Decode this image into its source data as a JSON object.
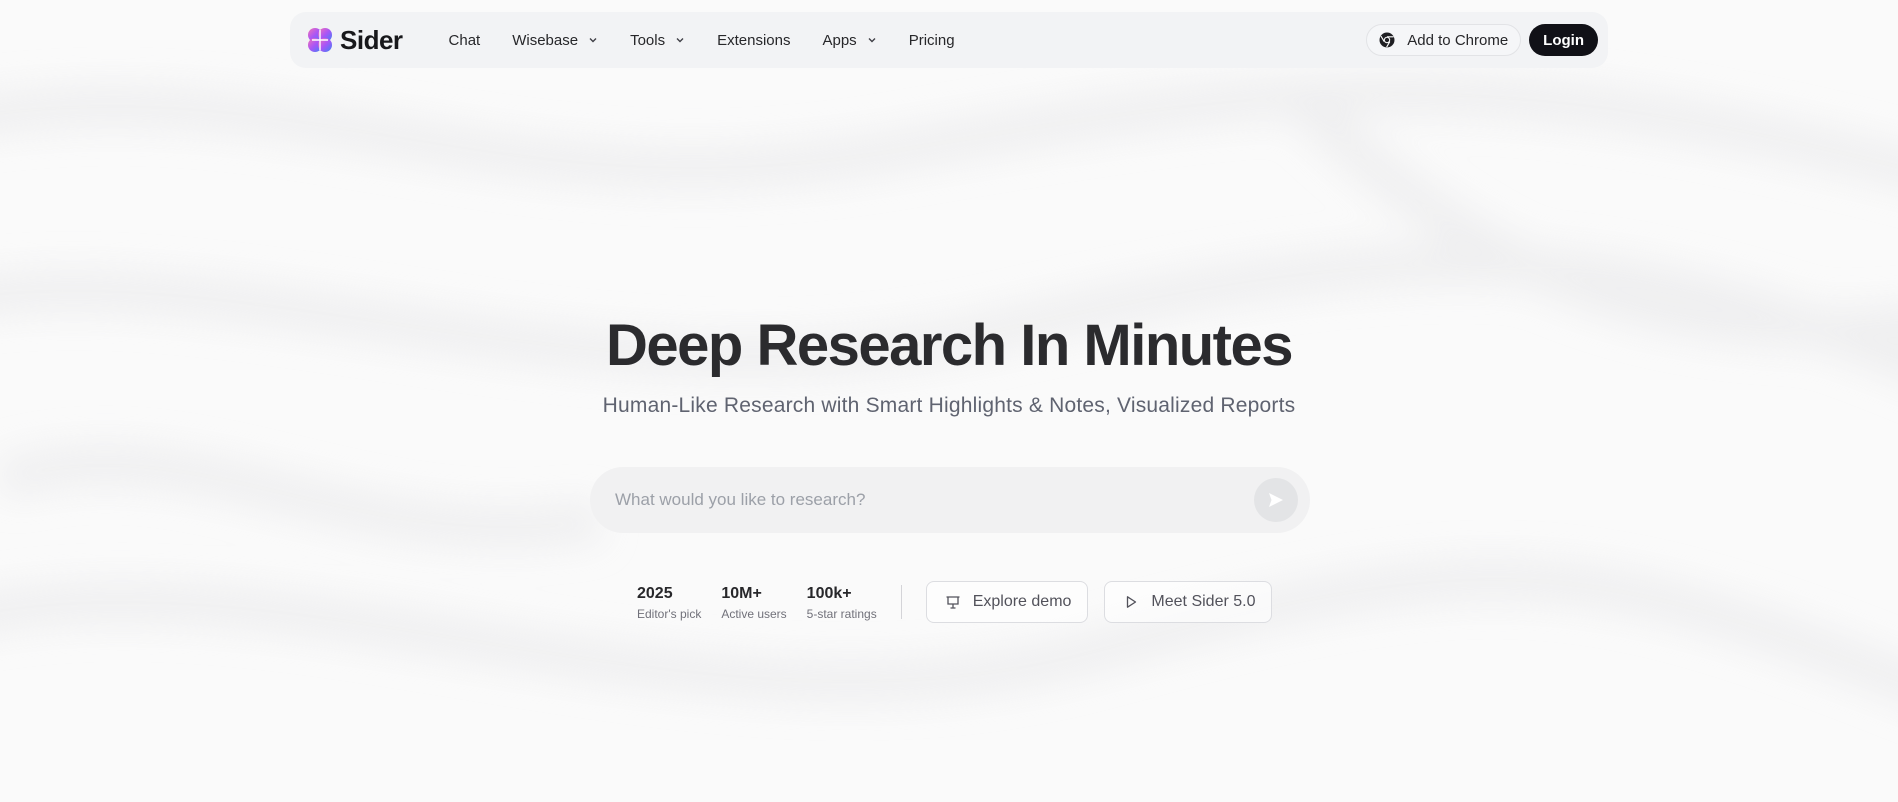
{
  "brand": {
    "name": "Sider"
  },
  "nav": {
    "items": [
      {
        "label": "Chat",
        "has_dropdown": false
      },
      {
        "label": "Wisebase",
        "has_dropdown": true
      },
      {
        "label": "Tools",
        "has_dropdown": true
      },
      {
        "label": "Extensions",
        "has_dropdown": false
      },
      {
        "label": "Apps",
        "has_dropdown": true
      },
      {
        "label": "Pricing",
        "has_dropdown": false
      }
    ],
    "add_to_chrome": "Add to Chrome",
    "login": "Login"
  },
  "hero": {
    "title": "Deep Research In Minutes",
    "subtitle": "Human-Like Research with Smart Highlights & Notes, Visualized Reports"
  },
  "search": {
    "placeholder": "What would you like to research?",
    "value": ""
  },
  "stats": [
    {
      "value": "2025",
      "label": "Editor's pick"
    },
    {
      "value": "10M+",
      "label": "Active users"
    },
    {
      "value": "100k+",
      "label": "5-star ratings"
    }
  ],
  "actions": {
    "explore_demo": "Explore demo",
    "meet_sider": "Meet Sider 5.0"
  },
  "colors": {
    "accent_dark": "#111117",
    "nav_bg": "#f2f3f5",
    "logo_gradient": [
      "#f472b6",
      "#a855f7",
      "#3b82f6"
    ]
  }
}
